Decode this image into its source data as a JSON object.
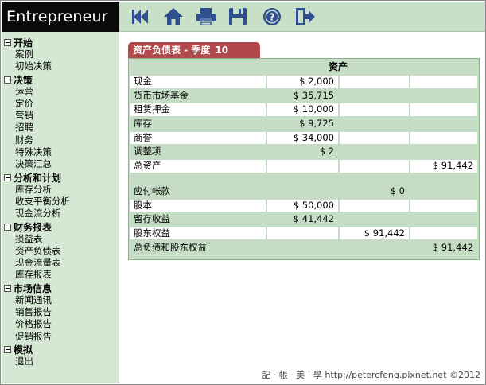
{
  "brand": "Entrepreneur",
  "toolbar": {
    "icons": [
      "back-icon",
      "home-icon",
      "print-icon",
      "save-icon",
      "help-icon",
      "exit-icon"
    ],
    "color": "#2f4f8f"
  },
  "sidebar": {
    "groups": [
      {
        "title": "开始",
        "items": [
          "案例",
          "初始决策"
        ]
      },
      {
        "title": "决策",
        "items": [
          "运营",
          "定价",
          "营销",
          "招聘",
          "财务",
          "特殊决策",
          "决策汇总"
        ]
      },
      {
        "title": "分析和计划",
        "items": [
          "库存分析",
          "收支平衡分析",
          "现金流分析"
        ]
      },
      {
        "title": "财务报表",
        "items": [
          "损益表",
          "资产负债表",
          "现金流量表",
          "库存报表"
        ]
      },
      {
        "title": "市场信息",
        "items": [
          "新闻通讯",
          "销售报告",
          "价格报告",
          "促销报告"
        ]
      },
      {
        "title": "模拟",
        "items": [
          "退出"
        ]
      }
    ]
  },
  "tab": {
    "label": "资产负债表 - 季度",
    "quarter": "10"
  },
  "sheet": {
    "header": "资产",
    "rows": [
      {
        "label": "现金",
        "c1": "$ 2,000",
        "c2": "",
        "c3": "",
        "shaded": false
      },
      {
        "label": "货币市场基金",
        "c1": "$ 35,715",
        "c2": "",
        "c3": "",
        "shaded": true
      },
      {
        "label": "租赁押金",
        "c1": "$ 10,000",
        "c2": "",
        "c3": "",
        "shaded": false
      },
      {
        "label": "库存",
        "c1": "$ 9,725",
        "c2": "",
        "c3": "",
        "shaded": true
      },
      {
        "label": "商誉",
        "c1": "$ 34,000",
        "c2": "",
        "c3": "",
        "shaded": false
      },
      {
        "label": "调整项",
        "c1": "$ 2",
        "c2": "",
        "c3": "",
        "shaded": true
      },
      {
        "label": "总资产",
        "c1": "",
        "c2": "",
        "c3": "$ 91,442",
        "shaded": false
      }
    ],
    "rows2": [
      {
        "label": "应付帐款",
        "c1": "",
        "c2": "$ 0",
        "c3": "",
        "shaded": true
      },
      {
        "label": "股本",
        "c1": "$ 50,000",
        "c2": "",
        "c3": "",
        "shaded": false
      },
      {
        "label": "留存收益",
        "c1": "$ 41,442",
        "c2": "",
        "c3": "",
        "shaded": true
      },
      {
        "label": "股东权益",
        "c1": "",
        "c2": "$ 91,442",
        "c3": "",
        "shaded": false
      },
      {
        "label": "总负债和股东权益",
        "c1": "",
        "c2": "",
        "c3": "$ 91,442",
        "shaded": true
      }
    ]
  },
  "watermark": "記 · 帳 · 美 · 學 http://petercfeng.pixnet.net ©2012"
}
